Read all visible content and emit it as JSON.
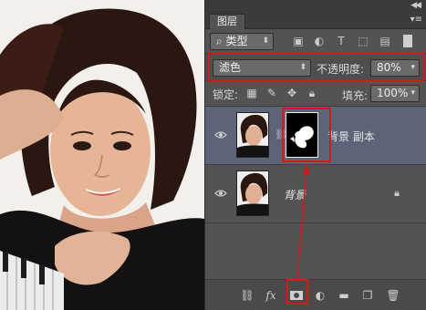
{
  "panel": {
    "collapse_icon": "double-arrow-icon",
    "tab_label": "图层",
    "menu_icon": "panel-menu-icon"
  },
  "filter": {
    "kind_label": "类型",
    "kind_icon": "search-icon"
  },
  "blend": {
    "mode": "滤色",
    "opacity_label": "不透明度:",
    "opacity_value": "80%"
  },
  "lock": {
    "label": "锁定:",
    "fill_label": "填充:",
    "fill_value": "100%"
  },
  "layers": [
    {
      "name": "背景 副本",
      "selected": true,
      "has_mask": true
    },
    {
      "name": "背景",
      "selected": false,
      "locked": true
    }
  ],
  "annotations": {
    "color": "#d21a1a"
  }
}
